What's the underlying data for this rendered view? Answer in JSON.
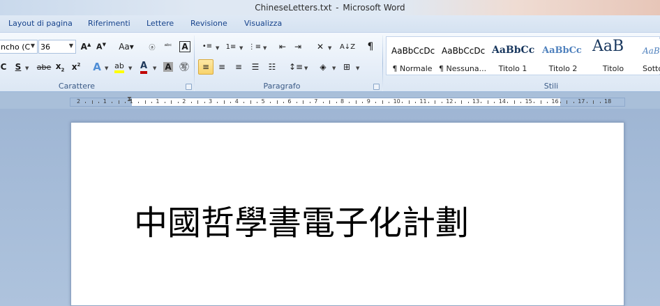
{
  "window": {
    "filename": "ChineseLetters.txt",
    "separator": "-",
    "app": "Microsoft Word"
  },
  "tabs": [
    "Layout di pagina",
    "Riferimenti",
    "Lettere",
    "Revisione",
    "Visualizza"
  ],
  "font": {
    "family_value": "ncho (C",
    "size_value": "36",
    "group_label": "Carattere",
    "color_accent": "#c00000",
    "highlight": "#ffff00"
  },
  "paragraph": {
    "group_label": "Paragrafo"
  },
  "styles": {
    "group_label": "Stili",
    "items": [
      {
        "sample": "AaBbCcDc",
        "name": "¶ Normale"
      },
      {
        "sample": "AaBbCcDc",
        "name": "¶ Nessuna..."
      },
      {
        "sample": "AaBbCc",
        "name": "Titolo 1"
      },
      {
        "sample": "AaBbCc",
        "name": "Titolo 2"
      },
      {
        "sample": "AaB",
        "name": "Titolo"
      },
      {
        "sample": "AaBl",
        "name": "Sotto"
      }
    ]
  },
  "ruler": {
    "labels": [
      "2",
      "1",
      "1",
      "1",
      "2",
      "3",
      "4",
      "5",
      "6",
      "7",
      "8",
      "9",
      "10",
      "11",
      "12",
      "13",
      "14",
      "15",
      "16",
      "17",
      "18"
    ]
  },
  "document": {
    "text": "中國哲學書電子化計劃"
  }
}
